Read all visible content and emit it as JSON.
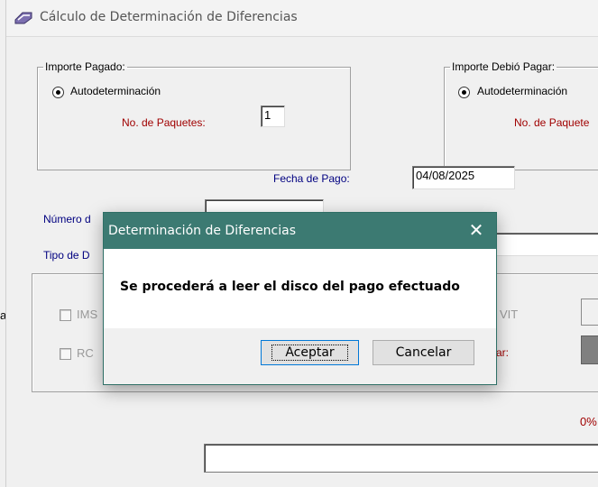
{
  "main_window": {
    "title": "Cálculo de Determinación de Diferencias",
    "side_fragment": "a"
  },
  "importe_pagado": {
    "legend": "Importe Pagado:",
    "radio_label": "Autodeterminación",
    "paquetes_label": "No. de Paquetes:",
    "paquetes_value": "1"
  },
  "importe_debio": {
    "legend": "Importe Debió Pagar:",
    "radio_label": "Autodeterminación",
    "paquetes_label": "No. de Paquete"
  },
  "fecha_pago": {
    "label": "Fecha de Pago:",
    "value": "04/08/2025"
  },
  "numero_label": "Número d",
  "tipo_label": "Tipo de D",
  "checks": {
    "ims": "IMS",
    "rc": "RC",
    "vit": "VIT",
    "ar": "ar:"
  },
  "progress": {
    "percent_text": "0%",
    "value": 0
  },
  "dialog": {
    "title": "Determinación de Diferencias",
    "close_glyph": "✕",
    "message": "Se procederá a leer el disco del pago efectuado",
    "ok_label": "Aceptar",
    "cancel_label": "Cancelar"
  },
  "colors": {
    "dialog_titlebar": "#3c7a72",
    "label_red": "#a00000",
    "label_navy": "#000080"
  }
}
